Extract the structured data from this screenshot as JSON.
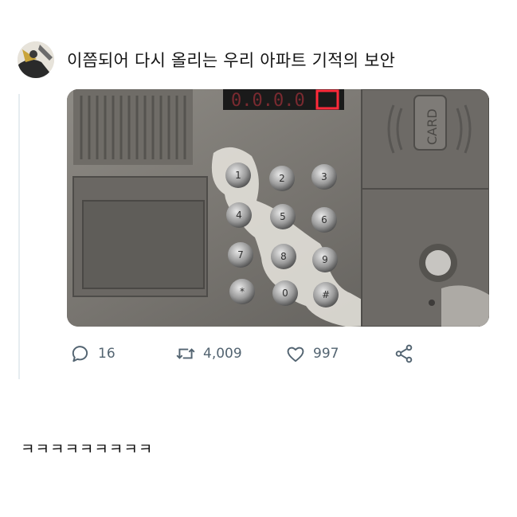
{
  "tweet": {
    "text": "이쯤되어 다시 올리는 우리 아파트 기적의 보안",
    "media": {
      "display_digits": "0.0.0.0",
      "card_label": "CARD",
      "keypad_keys": [
        "1",
        "2",
        "3",
        "4",
        "5",
        "6",
        "7",
        "8",
        "9",
        "*",
        "0",
        "#"
      ]
    },
    "actions": {
      "reply_count": "16",
      "retweet_count": "4,009",
      "like_count": "997"
    },
    "icons": {
      "reply": "reply-icon",
      "retweet": "retweet-icon",
      "like": "heart-icon",
      "share": "share-icon"
    }
  },
  "comment": {
    "text": "ㅋㅋㅋㅋㅋㅋㅋㅋㅋ"
  },
  "colors": {
    "action_gray": "#536471",
    "panel_metal": "#7d7a75",
    "led_red": "#ff2a3a"
  }
}
